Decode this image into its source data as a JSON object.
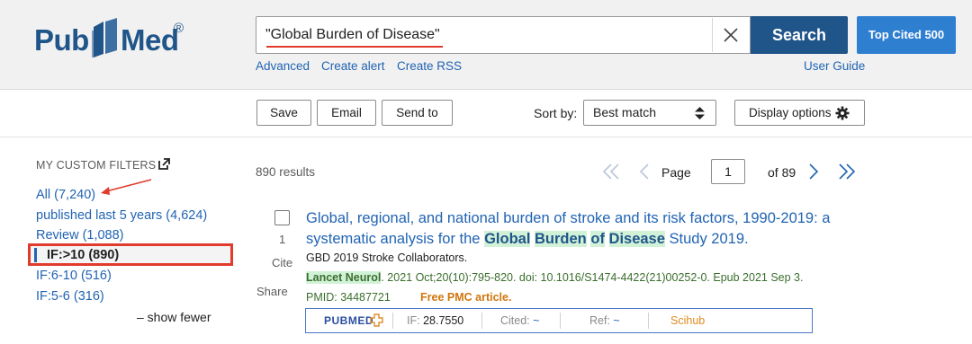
{
  "header": {
    "logo": {
      "part1": "Pub",
      "part2": "Med",
      "reg": "®"
    },
    "search": {
      "value": "\"Global Burden of Disease\""
    },
    "search_button": "Search",
    "top_cited_button": "Top Cited 500",
    "links": {
      "advanced": "Advanced",
      "create_alert": "Create alert",
      "create_rss": "Create RSS",
      "user_guide": "User Guide"
    },
    "colors": {
      "brand": "#20558a",
      "link": "#2164b3",
      "highlight_red": "#e03b2c"
    }
  },
  "toolbar": {
    "save": "Save",
    "email": "Email",
    "send_to": "Send to",
    "sort_label": "Sort by:",
    "sort_value": "Best match",
    "display_options": "Display options"
  },
  "sidebar": {
    "title": "MY CUSTOM FILTERS",
    "filters": [
      {
        "label": "All (7,240)"
      },
      {
        "label": "published last 5 years (4,624)"
      },
      {
        "label": "Review (1,088)"
      },
      {
        "label": "IF:>10 (890)",
        "active": true
      },
      {
        "label": "IF:6-10 (516)"
      },
      {
        "label": "IF:5-6 (316)"
      }
    ],
    "show_fewer": "– show fewer"
  },
  "results": {
    "count": "890 results",
    "page_label": "Page",
    "page_value": "1",
    "page_of": "of 89"
  },
  "article": {
    "number": "1",
    "cite": "Cite",
    "share": "Share",
    "title_pre": "Global, regional, and national burden of stroke and its risk factors, 1990-2019: a systematic analysis for the ",
    "title_hl": [
      "Global",
      "Burden",
      "of",
      "Disease"
    ],
    "title_post": " Study 2019.",
    "authors": "GBD 2019 Stroke Collaborators.",
    "journal": "Lancet Neurol",
    "citation": ". 2021 Oct;20(10):795-820. doi: 10.1016/S1474-4422(21)00252-0. Epub 2021 Sep 3.",
    "pmid": "PMID: 34487721",
    "free_pmc": "Free PMC article.",
    "ext": {
      "logo": "PUBMED",
      "if_label": "IF:",
      "if_value": "28.7550",
      "cited_label": "Cited:",
      "cited_value": "~",
      "ref_label": "Ref:",
      "ref_value": "~",
      "scihub": "Scihub"
    }
  }
}
